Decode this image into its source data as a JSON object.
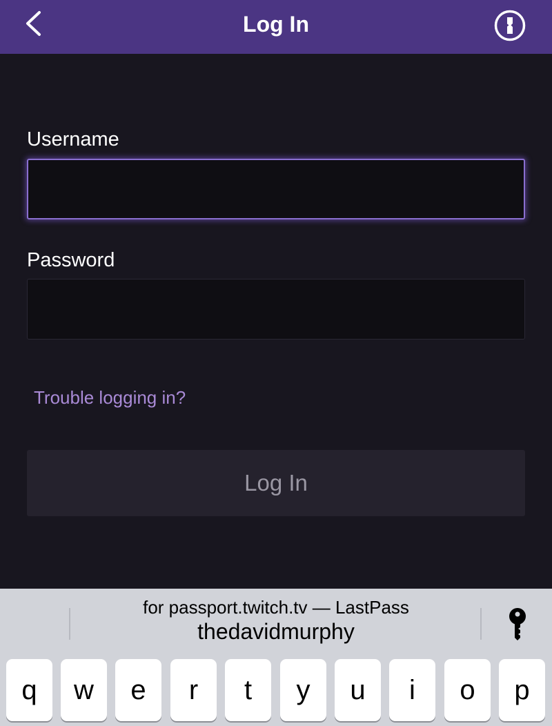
{
  "navbar": {
    "title": "Log In",
    "back_icon": "chevron-left-icon",
    "right_icon": "onepassword-icon"
  },
  "form": {
    "username_label": "Username",
    "username_value": "",
    "password_label": "Password",
    "password_value": "",
    "trouble_link": "Trouble logging in?",
    "login_button": "Log In"
  },
  "quicktype": {
    "subtitle": "for passport.twitch.tv — LastPass",
    "suggestion": "thedavidmurphy",
    "key_icon": "key-icon"
  },
  "keyboard": {
    "row1": [
      "q",
      "w",
      "e",
      "r",
      "t",
      "y",
      "u",
      "i",
      "o",
      "p"
    ]
  },
  "colors": {
    "navbar": "#4b3583",
    "background": "#18161f",
    "accent": "#a98ad6",
    "focus_border": "#8a6fd0"
  }
}
